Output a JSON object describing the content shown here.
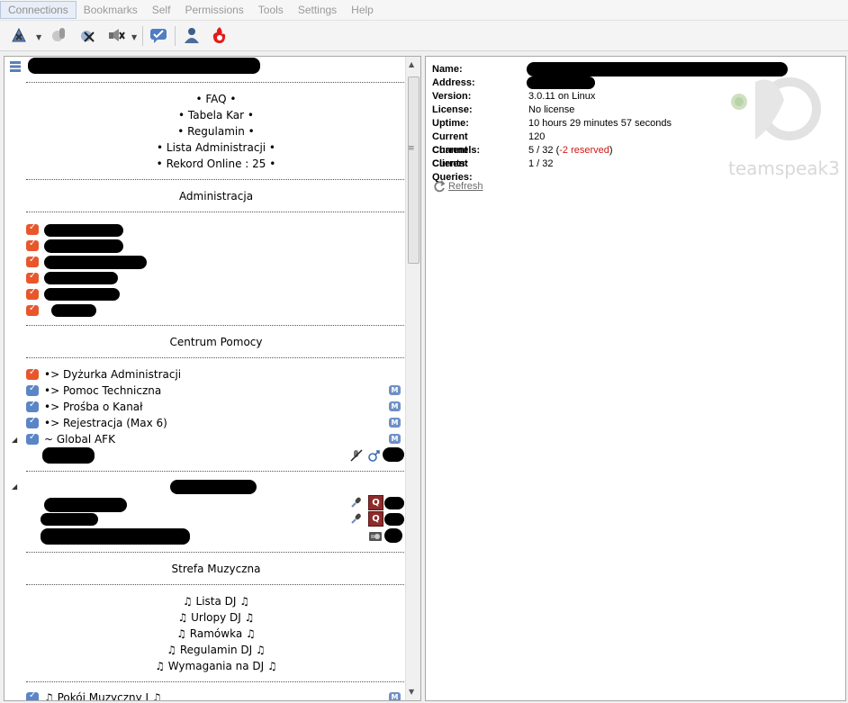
{
  "menu": {
    "items": [
      "Connections",
      "Bookmarks",
      "Self",
      "Permissions",
      "Tools",
      "Settings",
      "Help"
    ]
  },
  "toolbar": {
    "icons": [
      "connect-icon",
      "disconnect-icon",
      "away-icon",
      "mute-microphone-icon",
      "chat-icon",
      "contacts-icon",
      "teamspeak-flame-icon"
    ]
  },
  "tree": {
    "info_lines": [
      "• FAQ •",
      "• Tabela Kar •",
      "• Regulamin •",
      "• Lista Administracji •",
      "• Rekord Online : 25 •"
    ],
    "administracja_label": "Administracja",
    "centrum_label": "Centrum Pomocy",
    "help_channels": [
      "•> Dyżurka Administracji",
      "•> Pomoc Techniczna",
      "•> Prośba o Kanał",
      "•> Rejestracja (Max 6)"
    ],
    "afk_channel": "~ Global AFK",
    "strefa_label": "Strefa Muzyczna",
    "music_lines": [
      "♫ Lista DJ ♫",
      "♫ Urlopy DJ ♫",
      "♫ Ramówka ♫",
      "♫ Regulamin DJ ♫",
      "♫ Wymagania na DJ ♫"
    ],
    "bottom_channel": "♫ Pokój Muzyczny I ♫",
    "badge_letter": "M",
    "q_letter": "Q"
  },
  "info": {
    "name_label": "Name:",
    "address_label": "Address:",
    "version_label": "Version:",
    "version_value": "3.0.11 on Linux",
    "license_label": "License:",
    "license_value": "No license",
    "uptime_label": "Uptime:",
    "uptime_value": "10 hours 29 minutes 57 seconds",
    "channels_label": "Current Channels:",
    "channels_value": "120",
    "clients_label": "Current Clients:",
    "clients_value": "5 / 32 (",
    "clients_reserved": "-2 reserved",
    "clients_close": ")",
    "queries_label": "Current Queries:",
    "queries_value": "1 / 32",
    "refresh_label": "Refresh",
    "logo_text": "teamspeak3"
  },
  "colors": {
    "reserved": "#d01818",
    "admin_bubble": "#e8572c",
    "channel_bubble": "#5a86c6",
    "badge": "#6e8fc7"
  }
}
